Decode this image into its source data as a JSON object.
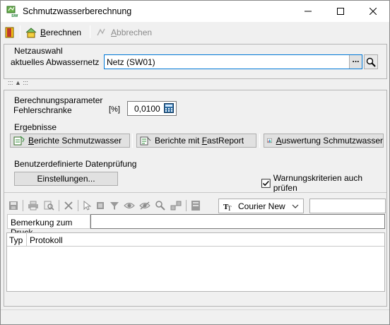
{
  "window": {
    "title": "Schmutzwasserberechnung",
    "minimize": "—",
    "maximize": "☐",
    "close": "✕"
  },
  "toolbar": {
    "berechnen_prefix": "B",
    "berechnen_rest": "erechnen",
    "abbrechen_prefix": "A",
    "abbrechen_rest": "bbrechen"
  },
  "netzauswahl": {
    "group_label": "Netzauswahl",
    "label": "aktuelles Abwassernetz",
    "value": "Netz (SW01)",
    "ellipsis": "...",
    "splitter_grip": "::: ▲ :::"
  },
  "parameter": {
    "group_label": "Berechnungsparameter",
    "label": "Fehlerschranke",
    "unit": "[%]",
    "value": "0,0100"
  },
  "ergebnisse": {
    "group_label": "Ergebnisse",
    "btn_berichte_pre": "B",
    "btn_berichte_rest": "erichte Schmutzwasser",
    "btn_fast_pre": "Berichte mit ",
    "btn_fast_u": "F",
    "btn_fast_rest": "astReport",
    "btn_auswertung_pre": "A",
    "btn_auswertung_rest": "uswertung Schmutzwasser"
  },
  "pruefung": {
    "group_label": "Benutzerdefinierte Datenprüfung",
    "einstellungen": "Einstellungen...",
    "checkbox_label": "Warnungskriterien auch prüfen",
    "checkbox_checked": true
  },
  "editor": {
    "font_name": "Courier New",
    "font_size": "",
    "bemerkung_label": "Bemerkung zum Druck",
    "bemerkung_value": "",
    "columns": [
      "Typ",
      "Protokoll"
    ]
  },
  "colors": {
    "accent_green": "#2f8f3a",
    "input_border_focus": "#0078d7"
  }
}
